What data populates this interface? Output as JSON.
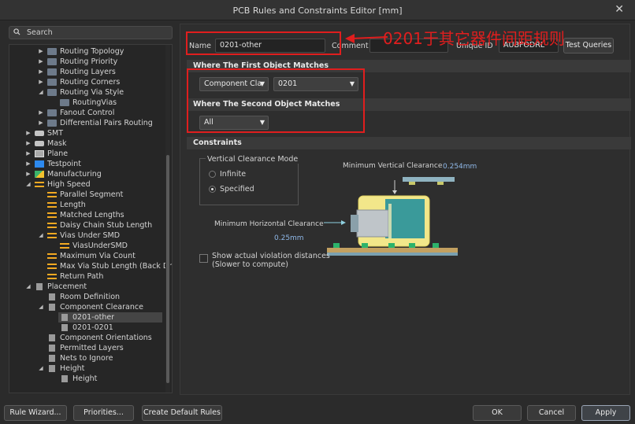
{
  "window": {
    "title": "PCB Rules and Constraints Editor [mm]",
    "close_glyph": "✕"
  },
  "search": {
    "placeholder": "Search"
  },
  "tree": {
    "items": [
      {
        "label": "Routing Topology"
      },
      {
        "label": "Routing Priority"
      },
      {
        "label": "Routing Layers"
      },
      {
        "label": "Routing Corners"
      },
      {
        "label": "Routing Via Style"
      },
      {
        "label": "RoutingVias"
      },
      {
        "label": "Fanout Control"
      },
      {
        "label": "Differential Pairs Routing"
      },
      {
        "label": "SMT"
      },
      {
        "label": "Mask"
      },
      {
        "label": "Plane"
      },
      {
        "label": "Testpoint"
      },
      {
        "label": "Manufacturing"
      },
      {
        "label": "High Speed"
      },
      {
        "label": "Parallel Segment"
      },
      {
        "label": "Length"
      },
      {
        "label": "Matched Lengths"
      },
      {
        "label": "Daisy Chain Stub Length"
      },
      {
        "label": "Vias Under SMD"
      },
      {
        "label": "ViasUnderSMD"
      },
      {
        "label": "Maximum Via Count"
      },
      {
        "label": "Max Via Stub Length (Back Drill"
      },
      {
        "label": "Return Path"
      },
      {
        "label": "Placement"
      },
      {
        "label": "Room Definition"
      },
      {
        "label": "Component Clearance"
      },
      {
        "label": "0201-other"
      },
      {
        "label": "0201-0201"
      },
      {
        "label": "Component Orientations"
      },
      {
        "label": "Permitted Layers"
      },
      {
        "label": "Nets to Ignore"
      },
      {
        "label": "Height"
      },
      {
        "label": "Height"
      }
    ]
  },
  "rule": {
    "name_label": "Name",
    "name_value": "0201-other",
    "comment_label": "Comment",
    "comment_value": "",
    "unique_id_label": "Unique ID",
    "unique_id_value": "AUBFODRL",
    "test_queries_label": "Test Queries"
  },
  "first_match": {
    "heading": "Where The First Object Matches",
    "type_value": "Component Cla",
    "object_value": "0201"
  },
  "second_match": {
    "heading": "Where The Second Object Matches",
    "type_value": "All"
  },
  "constraints": {
    "heading": "Constraints",
    "mode_group_label": "Vertical Clearance Mode",
    "mode_infinite": "Infinite",
    "mode_specified": "Specified",
    "mode_selected": "Specified",
    "min_vertical_label": "Minimum Vertical Clearance",
    "min_vertical_value": "0.254mm",
    "min_horizontal_label": "Minimum Horizontal Clearance",
    "min_horizontal_value": "0.25mm",
    "show_violation_line1": "Show actual violation distances",
    "show_violation_line2": "(Slower to compute)",
    "show_violation_checked": false
  },
  "annotation": {
    "text": "0201于其它器件间距规则",
    "color": "#e01e1e"
  },
  "buttons": {
    "rule_wizard": "Rule Wizard...",
    "priorities": "Priorities...",
    "create_default": "Create Default Rules",
    "ok": "OK",
    "cancel": "Cancel",
    "apply": "Apply"
  }
}
